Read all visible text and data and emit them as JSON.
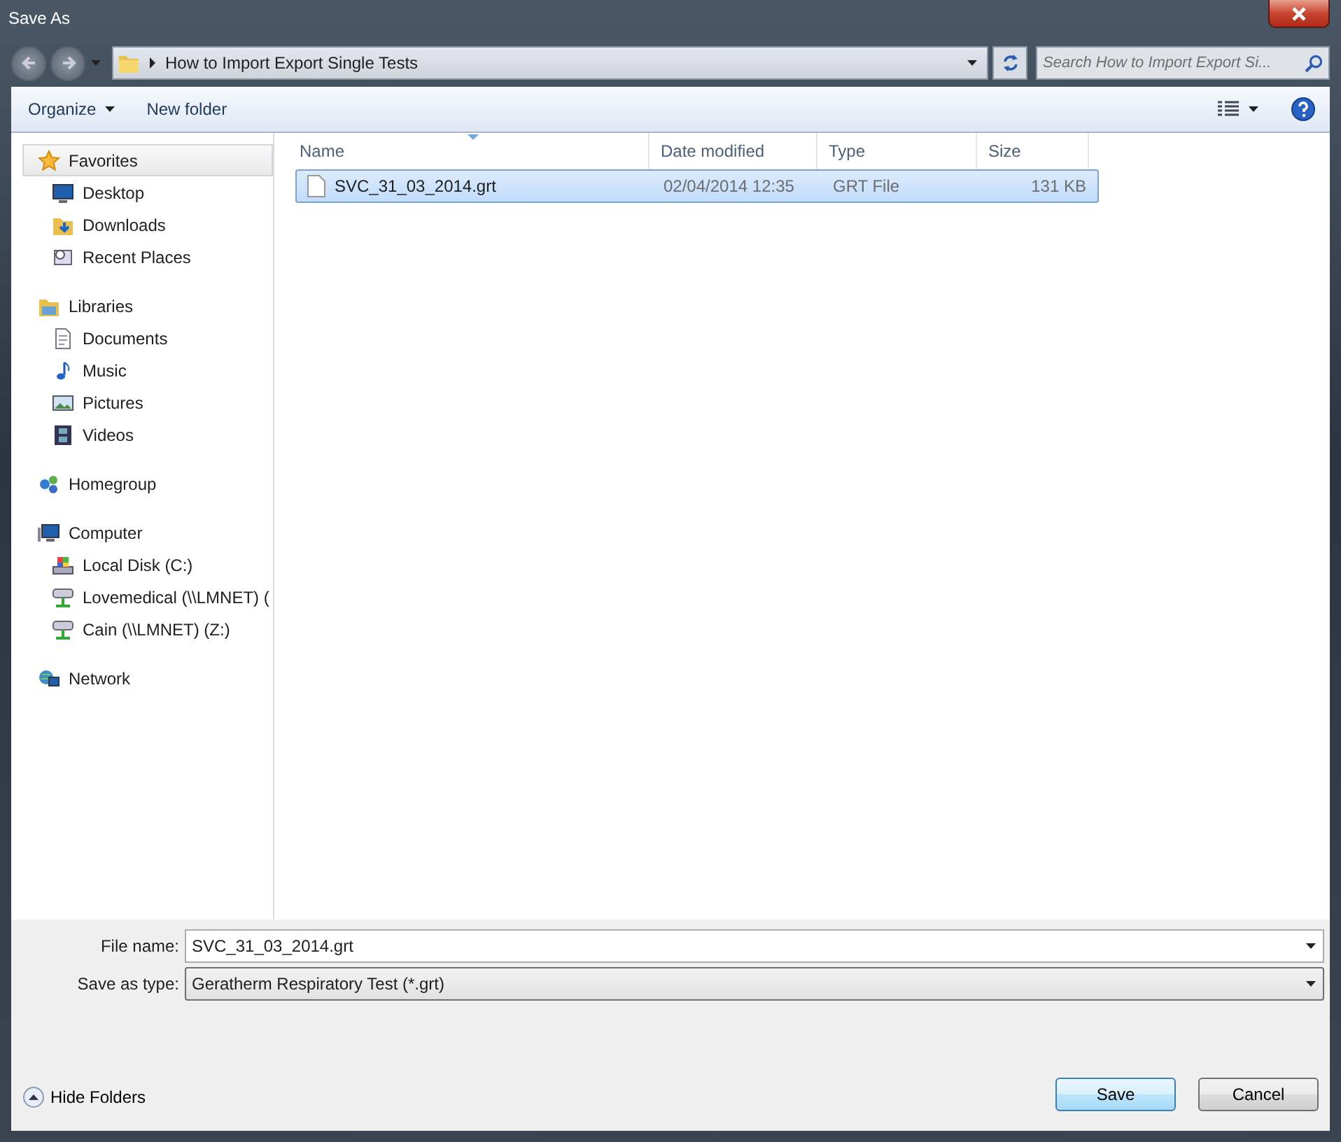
{
  "window": {
    "title": "Save As"
  },
  "address": {
    "path": "How to Import Export Single Tests",
    "search_placeholder": "Search How to Import Export Si..."
  },
  "toolbar": {
    "organize": "Organize",
    "new_folder": "New folder"
  },
  "sidebar": {
    "groups": [
      {
        "label": "Favorites",
        "selected": true,
        "children": [
          {
            "label": "Desktop",
            "selected": false
          },
          {
            "label": "Downloads",
            "selected": false
          },
          {
            "label": "Recent Places",
            "selected": false
          }
        ]
      },
      {
        "label": "Libraries",
        "selected": false,
        "children": [
          {
            "label": "Documents",
            "selected": false
          },
          {
            "label": "Music",
            "selected": false
          },
          {
            "label": "Pictures",
            "selected": false
          },
          {
            "label": "Videos",
            "selected": false
          }
        ]
      },
      {
        "label": "Homegroup",
        "selected": false
      },
      {
        "label": "Computer",
        "selected": false,
        "children": [
          {
            "label": "Local Disk (C:)",
            "selected": false
          },
          {
            "label": "Lovemedical (\\\\LMNET) (",
            "selected": false
          },
          {
            "label": "Cain (\\\\LMNET) (Z:)",
            "selected": false
          }
        ]
      },
      {
        "label": "Network",
        "selected": false
      }
    ]
  },
  "table": {
    "columns": [
      "Name",
      "Date modified",
      "Type",
      "Size"
    ],
    "rows": [
      {
        "cells": [
          "SVC_31_03_2014.grt",
          "02/04/2014 12:35",
          "GRT File",
          "131 KB"
        ],
        "selected": true
      }
    ]
  },
  "form": {
    "file_name_label": "File name:",
    "file_name": "SVC_31_03_2014.grt",
    "type_label": "Save as type:",
    "type": "Geratherm Respiratory Test (*.grt)"
  },
  "footer": {
    "hide_folders": "Hide Folders",
    "buttons": [
      {
        "label": "Save",
        "default": true
      },
      {
        "label": "Cancel",
        "default": false
      }
    ]
  }
}
